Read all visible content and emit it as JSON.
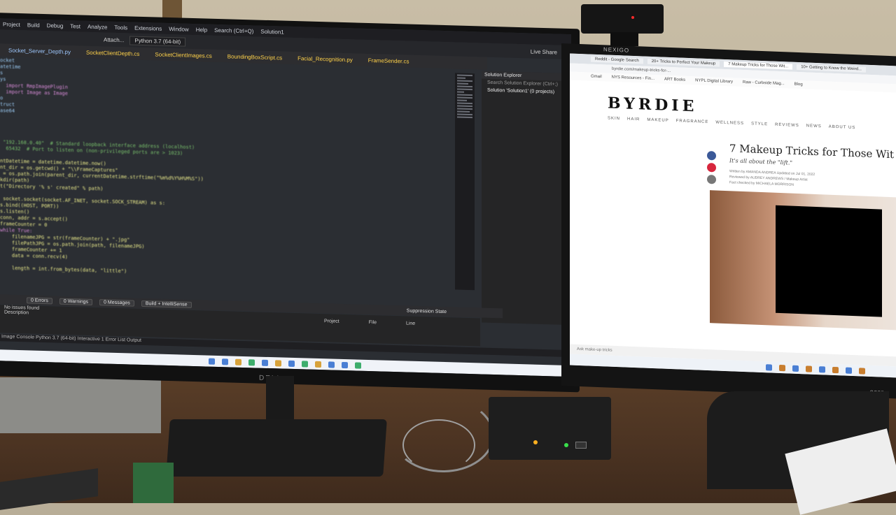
{
  "ide": {
    "menu": [
      "Project",
      "Build",
      "Debug",
      "Test",
      "Analyze",
      "Tools",
      "Extensions",
      "Window",
      "Help",
      "Search (Ctrl+Q)",
      "Solution1"
    ],
    "toolbar": {
      "attach_label": "Attach...",
      "python_env": "Python 3.7 (64-bit)",
      "live_share": "Live Share"
    },
    "tabs": [
      "Socket_Server_Depth.py",
      "SocketClientDepth.cs",
      "SocketClientImages.cs",
      "BoundingBoxScript.cs",
      "Facial_Recognition.py",
      "FrameSender.cs"
    ],
    "code_lines": [
      {
        "t": "ocket",
        "c": "mod"
      },
      {
        "t": "atetime",
        "c": "mod"
      },
      {
        "t": "s",
        "c": "mod"
      },
      {
        "t": "ys",
        "c": "mod"
      },
      {
        "t": "  import RmpImagePlugin",
        "c": "kw"
      },
      {
        "t": "  import Image as Image",
        "c": "kw"
      },
      {
        "t": "o",
        "c": "mod"
      },
      {
        "t": "truct",
        "c": "mod"
      },
      {
        "t": "ase64",
        "c": "mod"
      },
      {
        "t": "",
        "c": ""
      },
      {
        "t": "",
        "c": ""
      },
      {
        "t": "",
        "c": ""
      },
      {
        "t": "",
        "c": ""
      },
      {
        "t": " \"192.168.0.40\"  # Standard loopback interface address (localhost)",
        "c": "cm"
      },
      {
        "t": "  65432  # Port to listen on (non-privileged ports are > 1023)",
        "c": "cm"
      },
      {
        "t": "",
        "c": ""
      },
      {
        "t": "ntDatetime = datetime.datetime.now()",
        "c": "fn"
      },
      {
        "t": "nt_dir = os.getcwd() + \"\\\\FrameCaptures\"",
        "c": "fn"
      },
      {
        "t": " = os.path.join(parent_dir, currentDatetime.strftime(\"%m%d%Y%H%M%S\"))",
        "c": "fn"
      },
      {
        "t": "kdir(path)",
        "c": "fn"
      },
      {
        "t": "t(\"Directory '% s' created\" % path)",
        "c": "fn"
      },
      {
        "t": "",
        "c": ""
      },
      {
        "t": " socket.socket(socket.AF_INET, socket.SOCK_STREAM) as s:",
        "c": "fn"
      },
      {
        "t": "s.bind((HOST, PORT))",
        "c": "fn"
      },
      {
        "t": "s.listen()",
        "c": "fn"
      },
      {
        "t": "conn, addr = s.accept()",
        "c": "fn"
      },
      {
        "t": "frameCounter = 0",
        "c": "fn"
      },
      {
        "t": "while True:",
        "c": "kw"
      },
      {
        "t": "    filenameJPG = str(frameCounter) + \".jpg\"",
        "c": "fn"
      },
      {
        "t": "    filePathJPG = os.path.join(path, filenameJPG)",
        "c": "fn"
      },
      {
        "t": "    frameCounter += 1",
        "c": "fn"
      },
      {
        "t": "    data = conn.recv(4)",
        "c": "fn"
      },
      {
        "t": "",
        "c": ""
      },
      {
        "t": "    length = int.from_bytes(data, \"little\")",
        "c": "fn"
      }
    ],
    "solution_explorer": {
      "title": "Solution Explorer",
      "search": "Search Solution Explorer (Ctrl+;)",
      "item": "Solution 'Solution1' (0 projects)"
    },
    "error_list": {
      "errors": "0 Errors",
      "warnings": "0 Warnings",
      "messages": "0 Messages",
      "build": "Build + IntelliSense",
      "col_description": "Description",
      "col_project": "Project",
      "col_file": "File",
      "col_line": "Line",
      "col_suppression": "Suppression State",
      "no_issues": "No issues found"
    },
    "status": "Image Console   Python 3.7 (64-bit) Interactive 1   Error List   Output",
    "monitor_brand": "DELL"
  },
  "browser": {
    "tabs": [
      "Reddit - Google Search",
      "20+ Tricks to Perfect Your Makeup",
      "7 Makeup Tricks for Those Wit...",
      "10+ Getting to Know the Weird..."
    ],
    "address": "byrdie.com/makeup-tricks-for-...",
    "bookmarks": [
      "Gmail",
      "NYS Resources - Fin...",
      "ART Books",
      "NYPL Digital Library",
      "Raw - Curbside Mag...",
      "Blog"
    ],
    "site_logo": "BYRDIE",
    "site_nav": [
      "SKIN",
      "HAIR",
      "MAKEUP",
      "FRAGRANCE",
      "WELLNESS",
      "STYLE",
      "REVIEWS",
      "NEWS",
      "ABOUT US"
    ],
    "article_title": "7 Makeup Tricks for Those Wit",
    "article_subtitle": "It's all about the \"lift.\"",
    "byline": [
      "Written by AMANDA ANDREA   Updated on Jul 01, 2022",
      "Reviewed by AUDREY ANDREWS  /  Makeup Artist",
      "Fact checked by MICHAELA MORRISON"
    ],
    "bottom_tab": "Ask make-up tricks",
    "monitor_brand": "acer",
    "bezel_brand": "NEXIGO"
  },
  "colors": {
    "ide_bg": "#2b2e33",
    "accent_yellow": "#ffd24a",
    "browser_bg": "#ffffff",
    "redaction": "#000000"
  }
}
